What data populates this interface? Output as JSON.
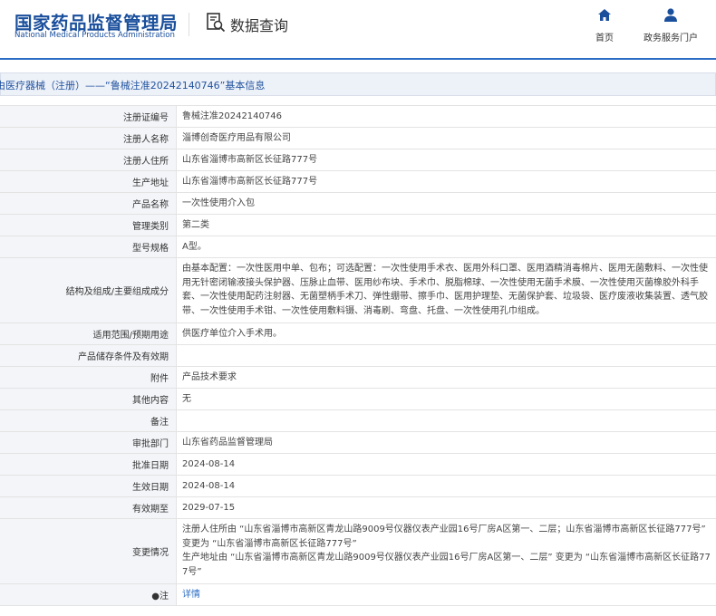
{
  "header": {
    "logo_cn": "国家药品监督管理局",
    "logo_en": "National Medical Products Administration",
    "search_label": "数据查询",
    "nav_home": "首页",
    "nav_portal": "政务服务门户"
  },
  "breadcrumb": "由医疗器械（注册）——“鲁械注准20242140746”基本信息",
  "rows": [
    {
      "label": "注册证编号",
      "value": "鲁械注准20242140746"
    },
    {
      "label": "注册人名称",
      "value": "淄博创奇医疗用品有限公司"
    },
    {
      "label": "注册人住所",
      "value": "山东省淄博市高新区长征路777号"
    },
    {
      "label": "生产地址",
      "value": "山东省淄博市高新区长征路777号"
    },
    {
      "label": "产品名称",
      "value": "一次性使用介入包"
    },
    {
      "label": "管理类别",
      "value": "第二类"
    },
    {
      "label": "型号规格",
      "value": "A型。"
    },
    {
      "label": "结构及组成/主要组成成分",
      "lines": [
        "由基本配置：一次性医用中单、包布；可选配置：一次性使用手术衣、医用外科口罩、医用酒精消毒棉片、医用无菌敷料、一次性使",
        "用无针密闭输液接头保护器、压脉止血带、医用纱布块、手术巾、脱脂棉球、一次性使用无菌手术膜、一次性使用灭菌橡胶外科手",
        "套、一次性使用配药注射器、无菌塑柄手术刀、弹性绷带、擦手巾、医用护理垫、无菌保护套、垃圾袋、医疗废液收集装置、透气胶",
        "带、一次性使用手术钳、一次性使用敷料镊、消毒刷、弯盘、托盘、一次性使用孔巾组成。"
      ]
    },
    {
      "label": "适用范围/预期用途",
      "value": "供医疗单位介入手术用。"
    },
    {
      "label": "产品储存条件及有效期",
      "value": ""
    },
    {
      "label": "附件",
      "value": "产品技术要求"
    },
    {
      "label": "其他内容",
      "value": "无"
    },
    {
      "label": "备注",
      "value": ""
    },
    {
      "label": "审批部门",
      "value": "山东省药品监督管理局"
    },
    {
      "label": "批准日期",
      "value": "2024-08-14"
    },
    {
      "label": "生效日期",
      "value": "2024-08-14"
    },
    {
      "label": "有效期至",
      "value": "2029-07-15"
    },
    {
      "label": "变更情况",
      "lines": [
        "注册人住所由 “山东省淄博市高新区青龙山路9009号仪器仪表产业园16号厂房A区第一、二层；山东省淄博市高新区长征路777号”",
        "变更为 “山东省淄博市高新区长征路777号”",
        "生产地址由 “山东省淄博市高新区青龙山路9009号仪器仪表产业园16号厂房A区第一、二层” 变更为 “山东省淄博市高新区长征路77",
        "7号”"
      ]
    },
    {
      "label": "●注",
      "value": "详情",
      "link": true
    }
  ],
  "colors": {
    "brand": "#1a4f9c",
    "accent": "#2b6cc4",
    "label_bg": "#f3f5f8"
  }
}
